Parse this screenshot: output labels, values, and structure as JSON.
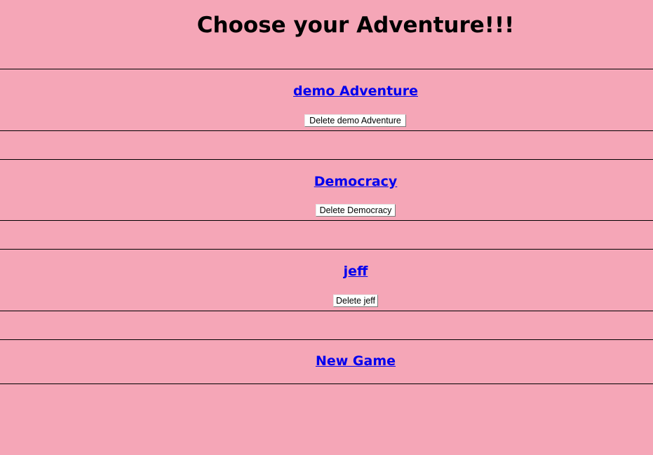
{
  "page": {
    "title": "Choose your Adventure!!!",
    "background": "#f5a6b7"
  },
  "games": [
    {
      "name": "demo Adventure",
      "delete_label": "Delete demo Adventure"
    },
    {
      "name": "Democracy",
      "delete_label": "Delete Democracy"
    },
    {
      "name": "jeff",
      "delete_label": "Delete jeff"
    }
  ],
  "new_game": {
    "label": "New Game"
  },
  "colors": {
    "link": "#0000ee",
    "border": "#000000"
  }
}
